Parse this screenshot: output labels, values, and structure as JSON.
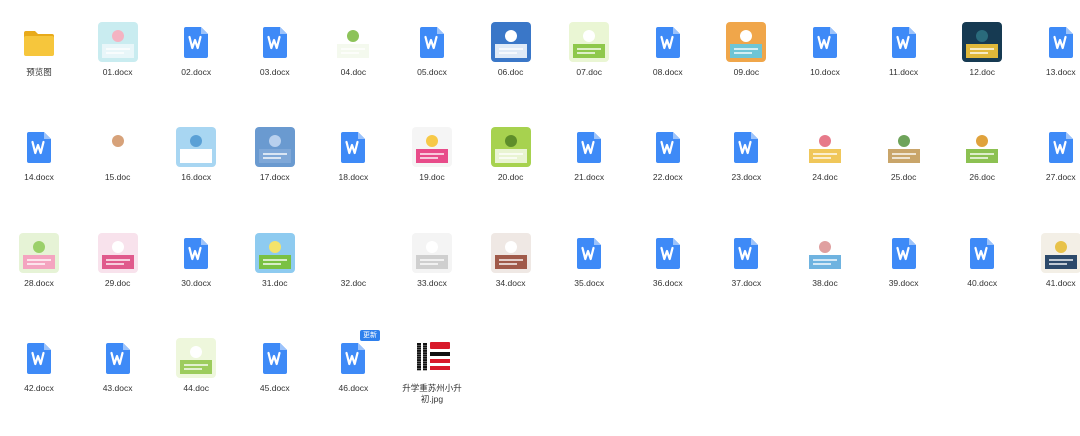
{
  "update_badge": "更新",
  "files": [
    {
      "name": "预览图",
      "icon": "folder-icon",
      "kind": "folder"
    },
    {
      "name": "01.docx",
      "icon": "document-thumbnail",
      "kind": "preview",
      "colors": [
        "#c9ecf0",
        "#e8f6f9",
        "#f4b3c2"
      ]
    },
    {
      "name": "02.docx",
      "icon": "wps-word-icon",
      "kind": "w"
    },
    {
      "name": "03.docx",
      "icon": "wps-word-icon",
      "kind": "w"
    },
    {
      "name": "04.doc",
      "icon": "document-thumbnail",
      "kind": "preview",
      "colors": [
        "#ffffff",
        "#f4f9ee",
        "#8dc35a"
      ]
    },
    {
      "name": "05.docx",
      "icon": "wps-word-icon",
      "kind": "w"
    },
    {
      "name": "06.doc",
      "icon": "document-thumbnail",
      "kind": "preview",
      "colors": [
        "#3a77c8",
        "#dfeaf7",
        "#ffffff"
      ]
    },
    {
      "name": "07.doc",
      "icon": "document-thumbnail",
      "kind": "preview",
      "colors": [
        "#eaf6d4",
        "#8fc84c",
        "#ffffff"
      ]
    },
    {
      "name": "08.docx",
      "icon": "wps-word-icon",
      "kind": "w"
    },
    {
      "name": "09.doc",
      "icon": "document-thumbnail",
      "kind": "preview",
      "colors": [
        "#f0a64a",
        "#6ec5d6",
        "#ffffff"
      ]
    },
    {
      "name": "10.docx",
      "icon": "wps-word-icon",
      "kind": "w"
    },
    {
      "name": "11.docx",
      "icon": "wps-word-icon",
      "kind": "w"
    },
    {
      "name": "12.doc",
      "icon": "document-thumbnail",
      "kind": "preview",
      "colors": [
        "#163a52",
        "#e0b83a",
        "#2a6b7c"
      ]
    },
    {
      "name": "13.docx",
      "icon": "wps-word-icon",
      "kind": "w"
    },
    {
      "name": "14.docx",
      "icon": "wps-word-icon",
      "kind": "w"
    },
    {
      "name": "15.doc",
      "icon": "document-thumbnail",
      "kind": "preview",
      "colors": [
        "#ffffff",
        "#ffffff",
        "#d7a27a"
      ]
    },
    {
      "name": "16.docx",
      "icon": "document-thumbnail",
      "kind": "preview",
      "colors": [
        "#a8d6f2",
        "#ffffff",
        "#5aa0d6"
      ]
    },
    {
      "name": "17.docx",
      "icon": "document-thumbnail",
      "kind": "preview",
      "colors": [
        "#6a9ad0",
        "#7fa8d8",
        "#b8d0ee"
      ]
    },
    {
      "name": "18.docx",
      "icon": "wps-word-icon",
      "kind": "w"
    },
    {
      "name": "19.doc",
      "icon": "document-thumbnail",
      "kind": "preview",
      "colors": [
        "#f5f5f5",
        "#e84c8a",
        "#f7c948"
      ]
    },
    {
      "name": "20.doc",
      "icon": "document-thumbnail",
      "kind": "preview",
      "colors": [
        "#a7d24f",
        "#e9f4d2",
        "#5e8e2a"
      ]
    },
    {
      "name": "21.docx",
      "icon": "wps-word-icon",
      "kind": "w"
    },
    {
      "name": "22.docx",
      "icon": "wps-word-icon",
      "kind": "w"
    },
    {
      "name": "23.docx",
      "icon": "wps-word-icon",
      "kind": "w"
    },
    {
      "name": "24.doc",
      "icon": "document-thumbnail",
      "kind": "preview",
      "colors": [
        "#ffffff",
        "#f0c75a",
        "#e77a8a"
      ]
    },
    {
      "name": "25.doc",
      "icon": "document-thumbnail",
      "kind": "preview",
      "colors": [
        "#ffffff",
        "#c9a56a",
        "#6ea35a"
      ]
    },
    {
      "name": "26.doc",
      "icon": "document-thumbnail",
      "kind": "preview",
      "colors": [
        "#ffffff",
        "#8cc152",
        "#e0a23c"
      ]
    },
    {
      "name": "27.docx",
      "icon": "wps-word-icon",
      "kind": "w"
    },
    {
      "name": "28.docx",
      "icon": "document-thumbnail",
      "kind": "preview",
      "colors": [
        "#e6f3d6",
        "#f4a4c0",
        "#9bd06a"
      ]
    },
    {
      "name": "29.doc",
      "icon": "document-thumbnail",
      "kind": "preview",
      "colors": [
        "#f8e2ec",
        "#e05a8c",
        "#ffffff"
      ]
    },
    {
      "name": "30.docx",
      "icon": "wps-word-icon",
      "kind": "w"
    },
    {
      "name": "31.doc",
      "icon": "document-thumbnail",
      "kind": "preview",
      "colors": [
        "#8ecbf0",
        "#7ac143",
        "#f4e36a"
      ]
    },
    {
      "name": "32.doc",
      "icon": "blank",
      "kind": "blank"
    },
    {
      "name": "33.docx",
      "icon": "document-thumbnail",
      "kind": "preview",
      "colors": [
        "#f4f4f4",
        "#cfcfcf",
        "#ffffff"
      ]
    },
    {
      "name": "34.docx",
      "icon": "document-thumbnail",
      "kind": "preview",
      "colors": [
        "#efe8e4",
        "#a05a4a",
        "#ffffff"
      ]
    },
    {
      "name": "35.docx",
      "icon": "wps-word-icon",
      "kind": "w"
    },
    {
      "name": "36.docx",
      "icon": "wps-word-icon",
      "kind": "w"
    },
    {
      "name": "37.docx",
      "icon": "wps-word-icon",
      "kind": "w"
    },
    {
      "name": "38.doc",
      "icon": "document-thumbnail",
      "kind": "preview",
      "colors": [
        "#ffffff",
        "#6fb3e0",
        "#e0a0a0"
      ]
    },
    {
      "name": "39.docx",
      "icon": "wps-word-icon",
      "kind": "w"
    },
    {
      "name": "40.docx",
      "icon": "wps-word-icon",
      "kind": "w"
    },
    {
      "name": "41.docx",
      "icon": "document-thumbnail",
      "kind": "preview",
      "colors": [
        "#f3efe6",
        "#2d4a6b",
        "#e8c24a"
      ]
    },
    {
      "name": "42.docx",
      "icon": "wps-word-icon",
      "kind": "w"
    },
    {
      "name": "43.docx",
      "icon": "wps-word-icon",
      "kind": "w"
    },
    {
      "name": "44.doc",
      "icon": "document-thumbnail",
      "kind": "preview",
      "colors": [
        "#eef7dc",
        "#9ccc5c",
        "#ffffff"
      ]
    },
    {
      "name": "45.docx",
      "icon": "wps-word-icon",
      "kind": "w"
    },
    {
      "name": "46.docx",
      "icon": "wps-word-icon",
      "kind": "w"
    },
    {
      "name": "升学重苏州小升初.jpg",
      "icon": "qr-promo-thumbnail",
      "kind": "qr",
      "colors": [
        "#d8192a",
        "#111111",
        "#ffffff"
      ]
    }
  ],
  "colors": {
    "word_blue": "#3e8af7",
    "folder_yellow": "#f6c63c",
    "folder_dark": "#e8aa1a"
  }
}
